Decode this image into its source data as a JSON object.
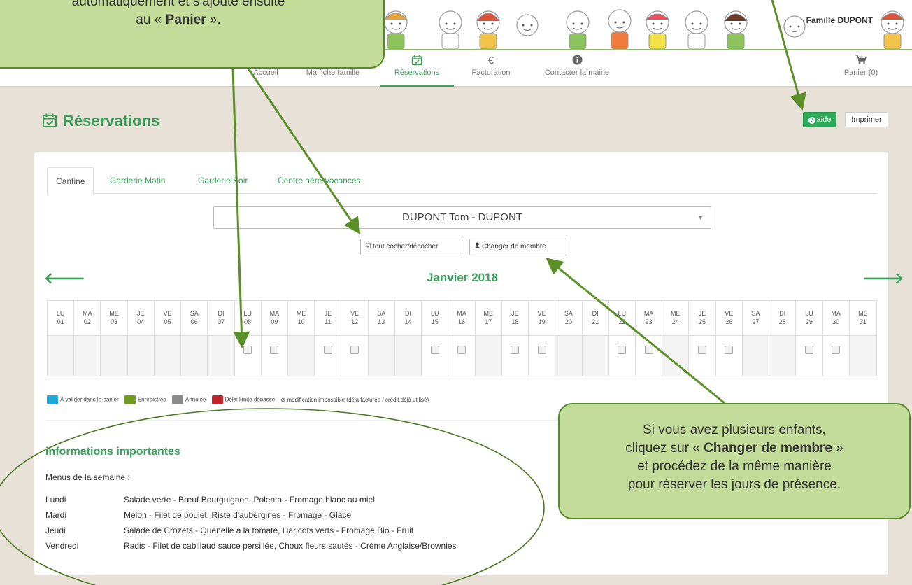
{
  "header": {
    "family_name": "Famille DUPONT"
  },
  "nav": {
    "items": [
      {
        "label": "Accueil",
        "icon": "home-icon"
      },
      {
        "label": "Ma fiche famille",
        "icon": "family-icon"
      },
      {
        "label": "Réservations",
        "icon": "calendar-check-icon",
        "active": true
      },
      {
        "label": "Facturation",
        "icon": "euro-icon"
      },
      {
        "label": "Contacter la mairie",
        "icon": "info-icon"
      }
    ],
    "cart_label": "Panier (0)"
  },
  "page": {
    "title": "Réservations",
    "help_button": "aide",
    "print_button": "Imprimer"
  },
  "tabs": [
    "Cantine",
    "Garderie Matin",
    "Garderie Soir",
    "Centre aéré Vacances"
  ],
  "member_select": {
    "value": "DUPONT Tom - DUPONT"
  },
  "buttons": {
    "toggle_all": "tout cocher/décocher",
    "change_member": "Changer de membre"
  },
  "calendar": {
    "month": "Janvier 2018",
    "days": [
      {
        "dow": "LU",
        "num": "01",
        "open": false
      },
      {
        "dow": "MA",
        "num": "02",
        "open": false
      },
      {
        "dow": "ME",
        "num": "03",
        "open": false
      },
      {
        "dow": "JE",
        "num": "04",
        "open": false
      },
      {
        "dow": "VE",
        "num": "05",
        "open": false
      },
      {
        "dow": "SA",
        "num": "06",
        "open": false
      },
      {
        "dow": "DI",
        "num": "07",
        "open": false
      },
      {
        "dow": "LU",
        "num": "08",
        "open": true
      },
      {
        "dow": "MA",
        "num": "09",
        "open": true
      },
      {
        "dow": "ME",
        "num": "10",
        "open": false
      },
      {
        "dow": "JE",
        "num": "11",
        "open": true
      },
      {
        "dow": "VE",
        "num": "12",
        "open": true
      },
      {
        "dow": "SA",
        "num": "13",
        "open": false
      },
      {
        "dow": "DI",
        "num": "14",
        "open": false
      },
      {
        "dow": "LU",
        "num": "15",
        "open": true
      },
      {
        "dow": "MA",
        "num": "16",
        "open": true
      },
      {
        "dow": "ME",
        "num": "17",
        "open": false
      },
      {
        "dow": "JE",
        "num": "18",
        "open": true
      },
      {
        "dow": "VE",
        "num": "19",
        "open": true
      },
      {
        "dow": "SA",
        "num": "20",
        "open": false
      },
      {
        "dow": "DI",
        "num": "21",
        "open": false
      },
      {
        "dow": "LU",
        "num": "22",
        "open": true
      },
      {
        "dow": "MA",
        "num": "23",
        "open": true
      },
      {
        "dow": "ME",
        "num": "24",
        "open": false
      },
      {
        "dow": "JE",
        "num": "25",
        "open": true
      },
      {
        "dow": "VE",
        "num": "26",
        "open": true
      },
      {
        "dow": "SA",
        "num": "27",
        "open": false
      },
      {
        "dow": "DI",
        "num": "28",
        "open": false
      },
      {
        "dow": "LU",
        "num": "29",
        "open": true
      },
      {
        "dow": "MA",
        "num": "30",
        "open": true
      },
      {
        "dow": "ME",
        "num": "31",
        "open": false
      }
    ]
  },
  "legend": [
    {
      "label": "À valider dans le panier",
      "color": "#1ea7d8"
    },
    {
      "label": "Enregistrée",
      "color": "#6f9c1e"
    },
    {
      "label": "Annulée",
      "color": "#8a8a8a"
    },
    {
      "label": "Délai limite dépassé",
      "color": "#c0242a"
    }
  ],
  "legend_note": "⊘ modification impossible (déjà facturée / crédit déjà utilisé)",
  "info": {
    "title": "informations importantes",
    "menus_heading": "Menus de la semaine :",
    "menus": [
      {
        "day": "Lundi",
        "text": "Salade verte - Bœuf Bourguignon, Polenta - Fromage blanc au miel"
      },
      {
        "day": "Mardi",
        "text": "Melon - Filet de poulet, Riste d'aubergines - Fromage - Glace"
      },
      {
        "day": "Jeudi",
        "text": "Salade de Crozets - Quenelle à la tomate, Haricots verts - Fromage Bio - Fruit"
      },
      {
        "day": "Vendredi",
        "text": "Radis - Filet de cabillaud sauce persillée, Choux fleurs sautés - Crème Anglaise/Brownies"
      }
    ]
  },
  "callouts": {
    "top_line1": "automatiquement et s'ajoute ensuite",
    "top_line2_pre": "au « ",
    "top_line2_bold": "Panier",
    "top_line2_post": " ».",
    "right_line1": "Si vous avez plusieurs enfants,",
    "right_line2_pre": "cliquez sur « ",
    "right_line2_bold": "Changer de membre",
    "right_line2_post": " »",
    "right_line3": "et procédez de la même manière",
    "right_line4": "pour réserver les jours de présence."
  },
  "colors": {
    "accent_green": "#3aa05a",
    "callout_fill": "#c4dc9a",
    "callout_border": "#548a2a",
    "arrow": "#5b8f27"
  }
}
